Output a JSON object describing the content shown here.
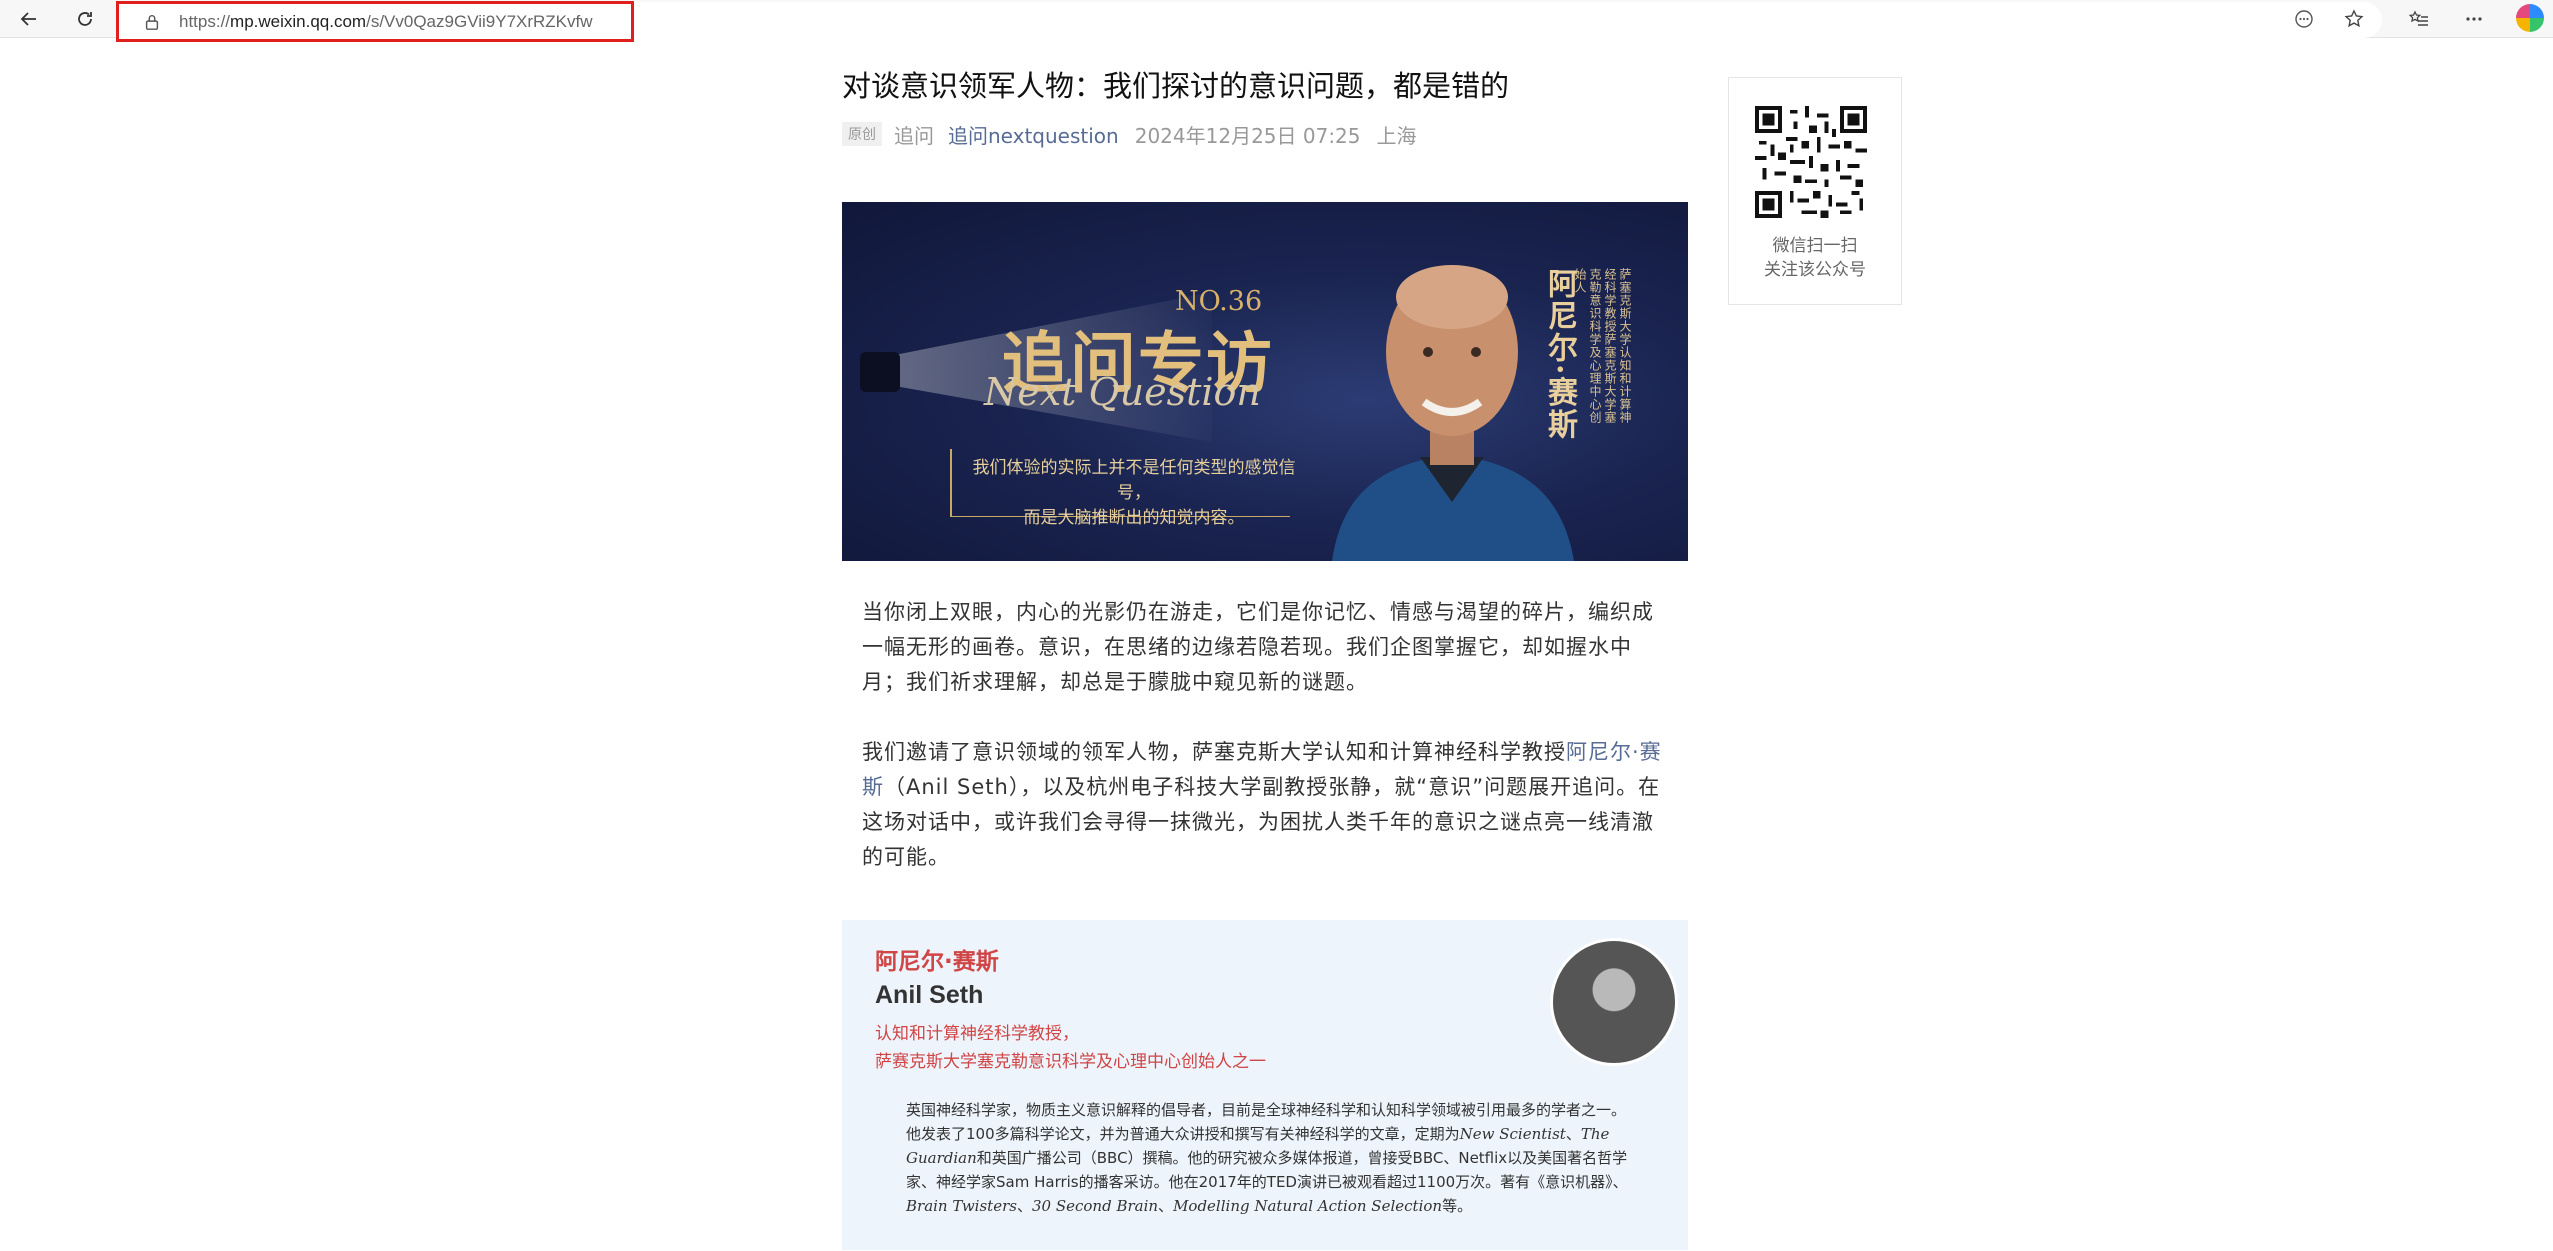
{
  "browser": {
    "url_prefix": "https://",
    "url_host": "mp.weixin.qq.com",
    "url_path": "/s/Vv0Qaz9GVii9Y7XrRZKvfw"
  },
  "article": {
    "title": "对谈意识领军人物：我们探讨的意识问题，都是错的",
    "badge": "原创",
    "author": "追问",
    "account": "追问nextquestion",
    "date": "2024年12月25日 07:25",
    "location": "上海"
  },
  "banner": {
    "issue": "NO.36",
    "title": "追问专访",
    "subtitle": "Next Question",
    "quote_line1": "我们体验的实际上并不是任何类型的感觉信号，",
    "quote_line2": "而是大脑推断出的知觉内容。",
    "side_name": "阿尼尔·赛斯",
    "side_sub": "萨塞克斯大学认知和计算神经科学教授萨塞克斯大学塞克勒意识科学及心理中心创始人"
  },
  "paragraphs": {
    "p1": "当你闭上双眼，内心的光影仍在游走，它们是你记忆、情感与渴望的碎片，编织成一幅无形的画卷。意识，在思绪的边缘若隐若现。我们企图掌握它，却如握水中月；我们祈求理解，却总是于朦胧中窥见新的谜题。",
    "p2_before": "我们邀请了意识领域的领军人物，萨塞克斯大学认知和计算神经科学教授",
    "p2_link": "阿尼尔·赛斯",
    "p2_after": "（Anil Seth），以及杭州电子科技大学副教授张静，就“意识”问题展开追问。在这场对话中，或许我们会寻得一抹微光，为困扰人类千年的意识之谜点亮一线清澈的可能。"
  },
  "profile": {
    "name_cn": "阿尼尔·赛斯",
    "name_en": "Anil Seth",
    "role1": "认知和计算神经科学教授，",
    "role2": "萨赛克斯大学塞克勒意识科学及心理中心创始人之一",
    "bio_a": "英国神经科学家，物质主义意识解释的倡导者，目前是全球神经科学和认知科学领域被引用最多的学者之一。他发表了100多篇科学论文，并为普通大众讲授和撰写有关神经科学的文章，定期为",
    "bio_i1": "New Scientist",
    "bio_b": "、",
    "bio_i2": "The Guardian",
    "bio_c": "和英国广播公司（BBC）撰稿。他的研究被众多媒体报道，曾接受BBC、Netflix以及美国著名哲学家、神经学家Sam Harris的播客采访。他在2017年的TED演讲已被观看超过1100万次。著有《意识机器》、",
    "bio_i3": "Brain Twisters",
    "bio_d": "、",
    "bio_i4": "30 Second Brain",
    "bio_e": "、",
    "bio_i5": "Modelling Natural Action Selection",
    "bio_f": "等。"
  },
  "sidebar": {
    "qr_caption1": "微信扫一扫",
    "qr_caption2": "关注该公众号"
  },
  "colors": {
    "link": "#576b95",
    "accent_red": "#d04545",
    "url_highlight": "#e0201c"
  }
}
